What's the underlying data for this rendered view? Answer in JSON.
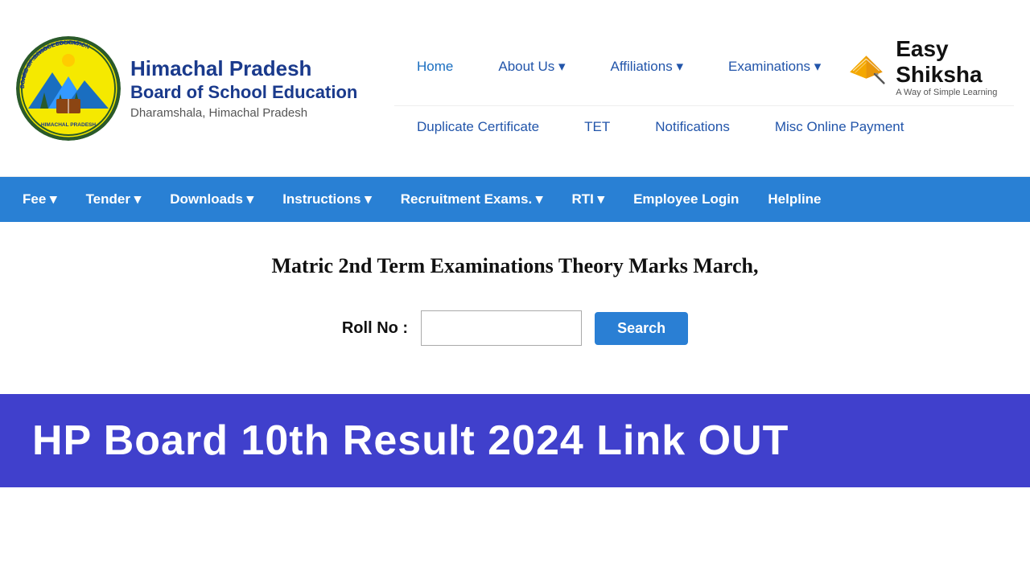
{
  "header": {
    "org_line1": "Himachal Pradesh",
    "org_line2": "Board of School Education",
    "org_location": "Dharamshala, Himachal Pradesh",
    "easy_shiksha_name": "Easy Shiksha",
    "easy_shiksha_tagline": "A Way of Simple Learning"
  },
  "top_nav_row1": [
    {
      "label": "Home",
      "active": true
    },
    {
      "label": "About Us ▾",
      "active": false
    },
    {
      "label": "Affiliations ▾",
      "active": false
    },
    {
      "label": "Examinations ▾",
      "active": false
    }
  ],
  "top_nav_row2": [
    {
      "label": "Duplicate Certificate"
    },
    {
      "label": "TET"
    },
    {
      "label": "Notifications"
    },
    {
      "label": "Misc Online Payment"
    }
  ],
  "blue_nav": [
    {
      "label": "Fee ▾"
    },
    {
      "label": "Tender ▾"
    },
    {
      "label": "Downloads ▾"
    },
    {
      "label": "Instructions ▾"
    },
    {
      "label": "Recruitment Exams. ▾"
    },
    {
      "label": "RTI ▾"
    },
    {
      "label": "Employee Login"
    },
    {
      "label": "Helpline"
    }
  ],
  "main": {
    "exam_title": "Matric 2nd Term Examinations Theory Marks March,",
    "roll_label": "Roll No :",
    "roll_placeholder": "",
    "search_button": "Search"
  },
  "banner": {
    "text": "HP Board 10th Result 2024 Link OUT"
  }
}
